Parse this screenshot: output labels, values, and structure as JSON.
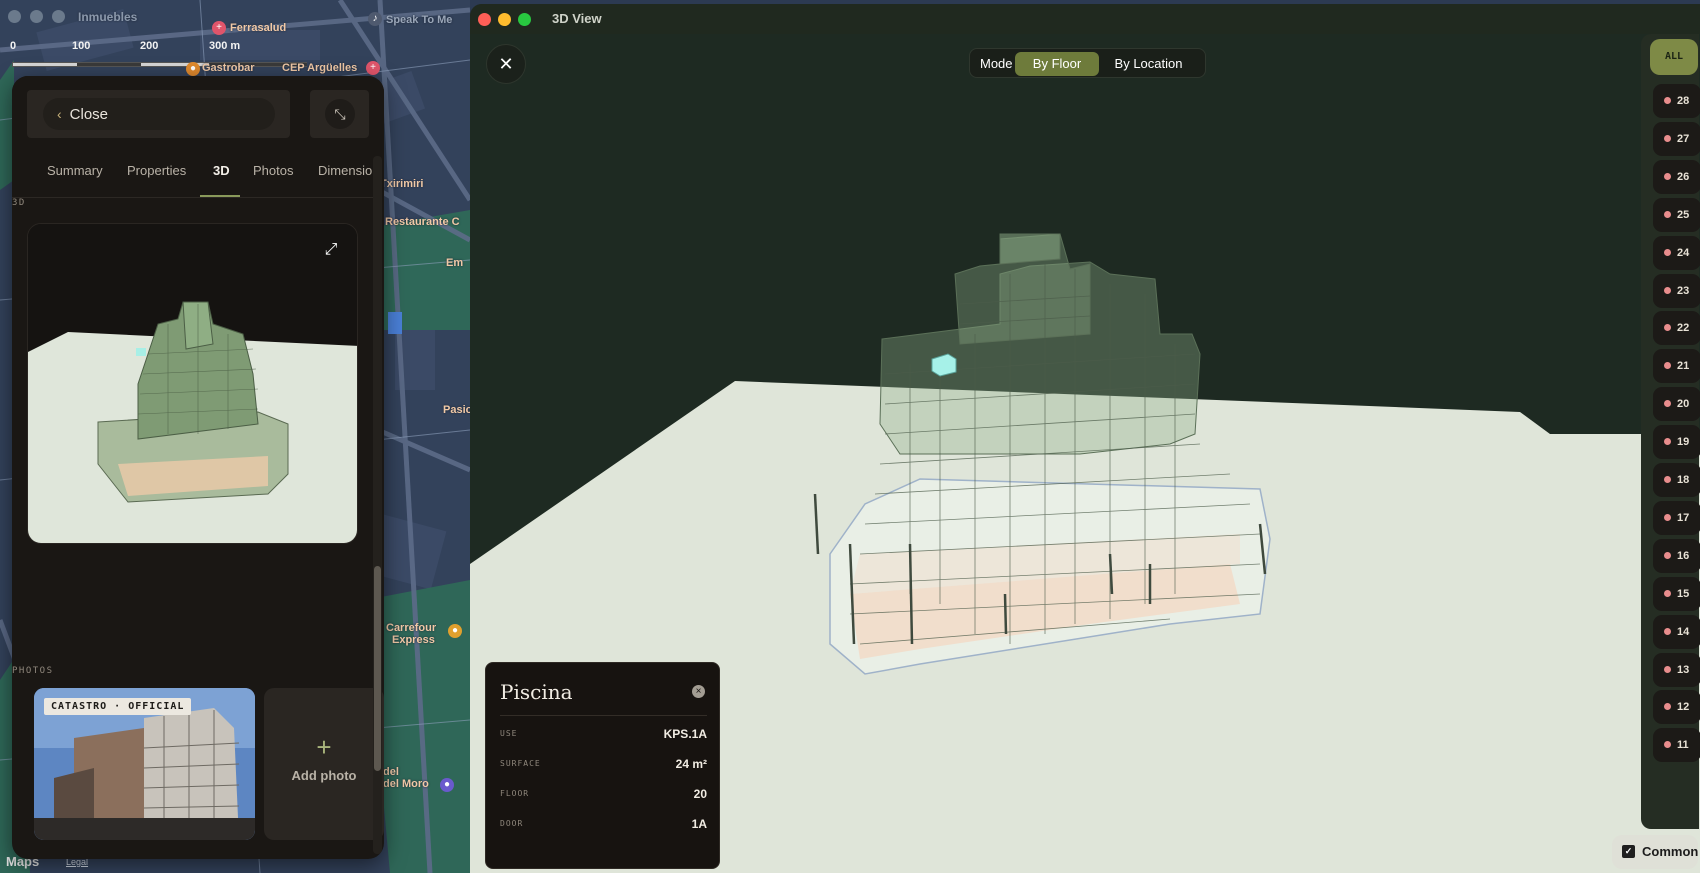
{
  "map": {
    "app_title": "Inmuebles",
    "scale_labels": [
      "0",
      "100",
      "200",
      "300 m"
    ],
    "labels": [
      {
        "text": "Ferrasalud",
        "cls": ""
      },
      {
        "text": "Speak To Me",
        "cls": "white"
      },
      {
        "text": "Gastrobar",
        "cls": ""
      },
      {
        "text": "CEP Argüelles",
        "cls": ""
      },
      {
        "text": "Txirimiri",
        "cls": ""
      },
      {
        "text": "Restaurante C",
        "cls": ""
      },
      {
        "text": "Em",
        "cls": ""
      },
      {
        "text": "Pasio",
        "cls": ""
      },
      {
        "text": "Carrefour",
        "cls": ""
      },
      {
        "text": "Express",
        "cls": ""
      },
      {
        "text": "del Moro",
        "cls": ""
      },
      {
        "text": "del",
        "cls": ""
      }
    ],
    "brand": "Maps",
    "legal": "Legal"
  },
  "panel": {
    "close_label": "Close",
    "tabs": [
      "Summary",
      "Properties",
      "3D",
      "Photos",
      "Dimensio"
    ],
    "active_tab": "3D",
    "section_3d": "3D",
    "section_photos": "PHOTOS",
    "photo_tag": "CATASTRO · OFFICIAL",
    "add_photo_label": "Add photo",
    "add_photo_symbol": "+"
  },
  "window": {
    "title": "3D View",
    "mode_label": "Mode",
    "mode_options": [
      "By Floor",
      "By Location"
    ],
    "mode_selected": "By Floor",
    "floor_all_label": "ALL",
    "floors": [
      "28",
      "27",
      "26",
      "25",
      "24",
      "23",
      "22",
      "21",
      "20",
      "19",
      "18",
      "17",
      "16",
      "15",
      "14",
      "13",
      "12",
      "11"
    ],
    "common_label": "Common",
    "common_checked": true
  },
  "info": {
    "title": "Piscina",
    "rows": [
      {
        "key": "USE",
        "value": "KPS.1A"
      },
      {
        "key": "SURFACE",
        "value": "24 m²"
      },
      {
        "key": "FLOOR",
        "value": "20"
      },
      {
        "key": "DOOR",
        "value": "1A"
      }
    ]
  },
  "colors": {
    "accent_olive": "#6e7b3b",
    "floor_dot": "#e88d8d",
    "scene_bg": "#1e2a22",
    "ground": "#dfe4d8",
    "panel_bg": "#1a1714"
  }
}
